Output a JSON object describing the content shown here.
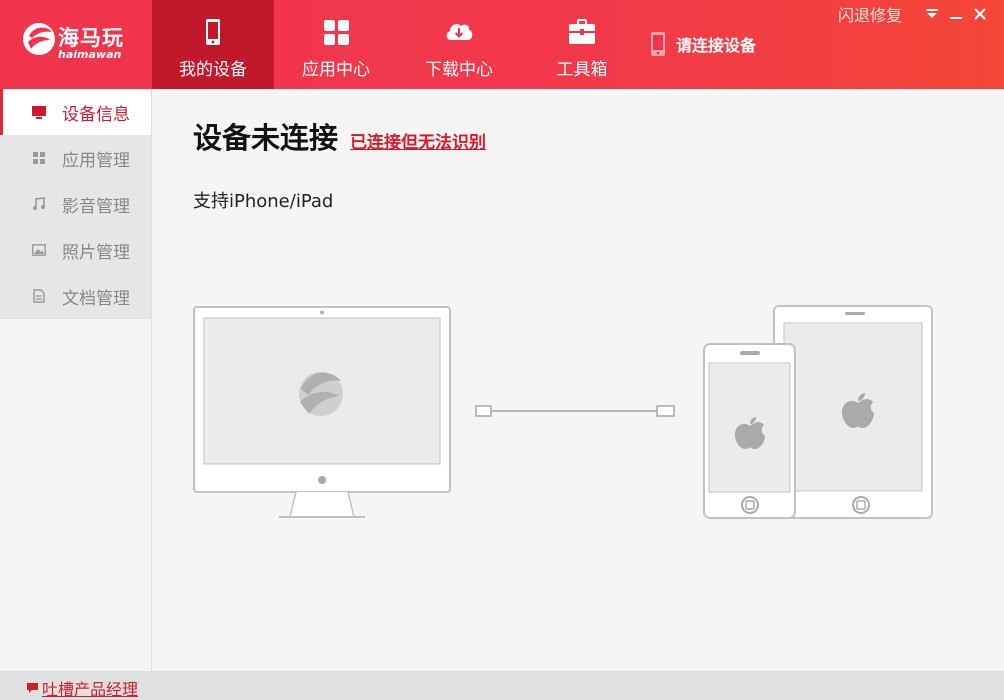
{
  "app": {
    "logo_cn": "海马玩",
    "logo_en": "haimawan"
  },
  "nav": {
    "tabs": [
      {
        "label": "我的设备",
        "icon": "phone-icon",
        "active": true
      },
      {
        "label": "应用中心",
        "icon": "apps-grid-icon",
        "active": false
      },
      {
        "label": "下载中心",
        "icon": "cloud-download-icon",
        "active": false
      },
      {
        "label": "工具箱",
        "icon": "toolbox-icon",
        "active": false
      }
    ],
    "connect_hint": "请连接设备"
  },
  "window": {
    "crash_fix": "闪退修复",
    "menu_icon": "triangle-down-icon",
    "minimize_icon": "minimize-icon",
    "close_icon": "close-icon"
  },
  "sidebar": {
    "items": [
      {
        "label": "设备信息",
        "icon": "monitor-icon",
        "active": true
      },
      {
        "label": "应用管理",
        "icon": "grid-icon",
        "active": false
      },
      {
        "label": "影音管理",
        "icon": "music-note-icon",
        "active": false
      },
      {
        "label": "照片管理",
        "icon": "picture-icon",
        "active": false
      },
      {
        "label": "文档管理",
        "icon": "document-icon",
        "active": false
      }
    ]
  },
  "main": {
    "title": "设备未连接",
    "unrecognized_link": "已连接但无法识别",
    "support_text": "支持iPhone/iPad"
  },
  "footer": {
    "feedback": "吐槽产品经理"
  },
  "colors": {
    "brand_red": "#f0344d",
    "active_tab": "#c1182c",
    "link_red": "#d81b2a"
  }
}
